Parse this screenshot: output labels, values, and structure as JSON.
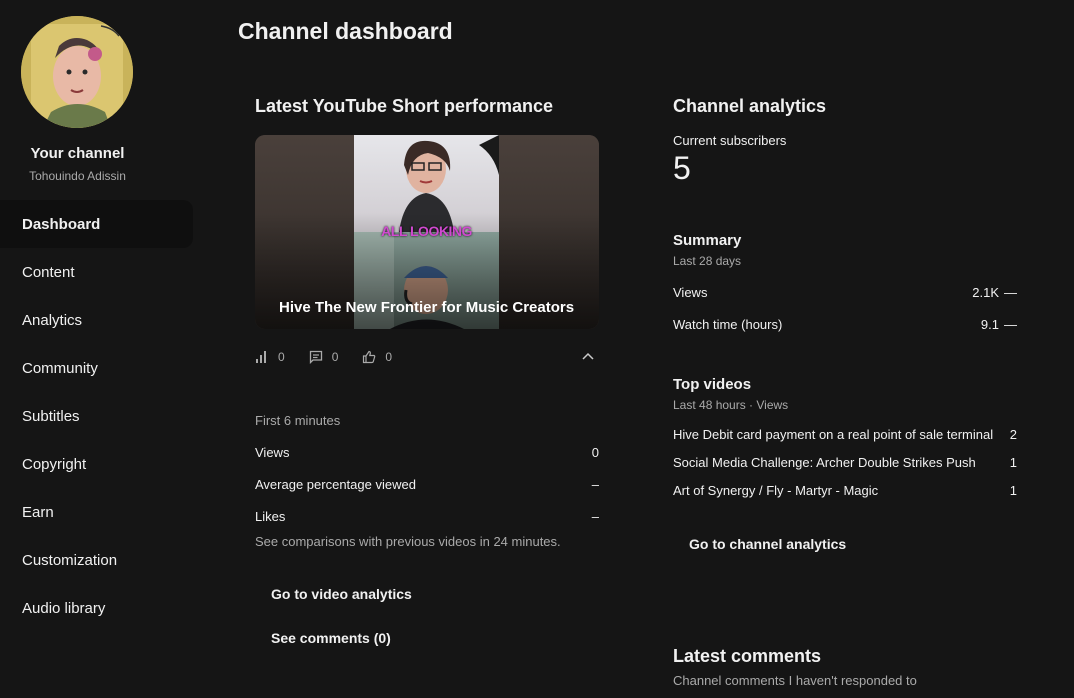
{
  "sidebar": {
    "channel_title": "Your channel",
    "channel_name": "Tohouindo Adissin",
    "items": [
      {
        "label": "Dashboard",
        "active": true
      },
      {
        "label": "Content"
      },
      {
        "label": "Analytics"
      },
      {
        "label": "Community"
      },
      {
        "label": "Subtitles"
      },
      {
        "label": "Copyright"
      },
      {
        "label": "Earn"
      },
      {
        "label": "Customization"
      },
      {
        "label": "Audio library"
      }
    ]
  },
  "header": {
    "title": "Channel dashboard"
  },
  "short": {
    "card_title": "Latest YouTube Short performance",
    "thumb_caption": "ALL LOOKING",
    "video_title": "Hive The New Frontier for Music Creators",
    "stats": {
      "views": "0",
      "comments": "0",
      "likes": "0"
    },
    "period_label": "First 6 minutes",
    "metrics": [
      {
        "label": "Views",
        "value": "0"
      },
      {
        "label": "Average percentage viewed",
        "value": "–"
      },
      {
        "label": "Likes",
        "value": "–"
      }
    ],
    "note": "See comparisons with previous videos in 24 minutes.",
    "video_analytics_btn": "Go to video analytics",
    "comments_btn": "See comments (0)"
  },
  "analytics": {
    "card_title": "Channel analytics",
    "subs_label": "Current subscribers",
    "subs_value": "5",
    "summary_title": "Summary",
    "summary_period": "Last 28 days",
    "summary_rows": [
      {
        "label": "Views",
        "value": "2.1K",
        "trend": "—"
      },
      {
        "label": "Watch time (hours)",
        "value": "9.1",
        "trend": "—"
      }
    ],
    "top_title": "Top videos",
    "top_period": "Last 48 hours · Views",
    "top_videos": [
      {
        "title": "Hive Debit card payment on a real point of sale terminal",
        "views": "2"
      },
      {
        "title": "Social Media Challenge: Archer Double Strikes Push",
        "views": "1"
      },
      {
        "title": "Art of Synergy / Fly - Martyr - Magic",
        "views": "1"
      }
    ],
    "channel_analytics_btn": "Go to channel analytics"
  },
  "comments": {
    "card_title": "Latest comments",
    "subtitle": "Channel comments I haven't responded to"
  }
}
